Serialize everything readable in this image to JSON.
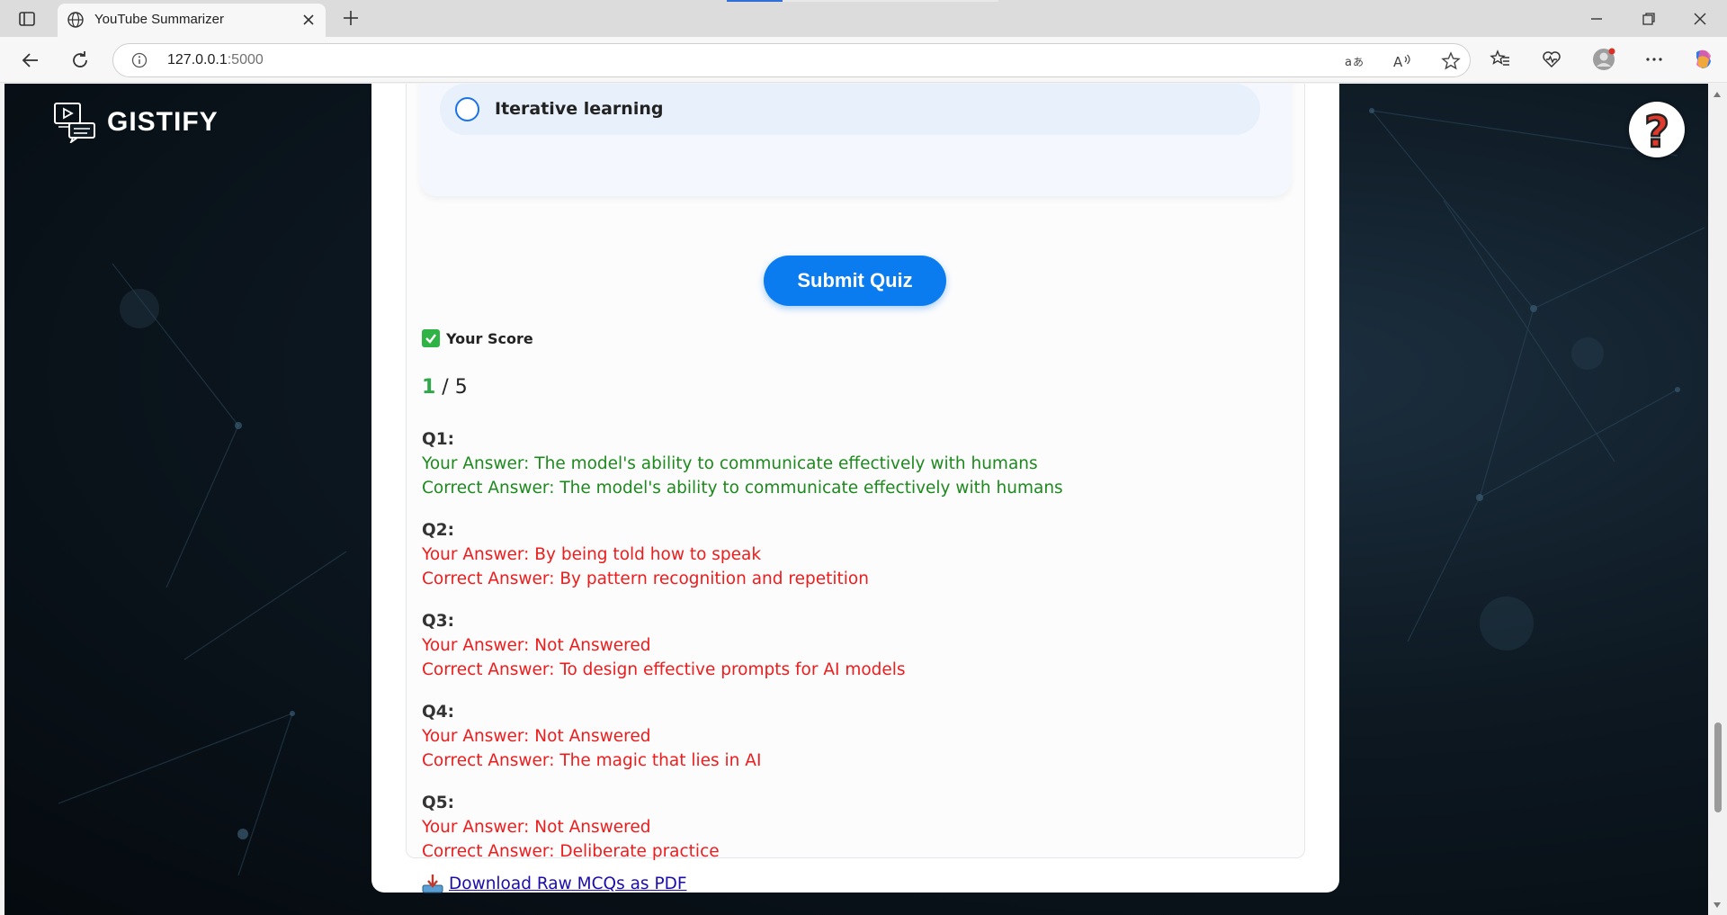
{
  "browser": {
    "tab_title": "YouTube Summarizer",
    "url_host": "127.0.0.1",
    "url_port": ":5000"
  },
  "app": {
    "brand": "GISTIFY",
    "help_symbol": "?"
  },
  "quiz": {
    "visible_option": "Iterative learning",
    "submit_label": "Submit Quiz",
    "score_heading": "Your Score",
    "score_got": "1",
    "score_sep": " / ",
    "score_total": "5",
    "results": [
      {
        "q": "Q1:",
        "your": "Your Answer: The model's ability to communicate effectively with humans",
        "correct": "Correct Answer: The model's ability to communicate effectively with humans",
        "status": "correct"
      },
      {
        "q": "Q2:",
        "your": "Your Answer: By being told how to speak",
        "correct": "Correct Answer: By pattern recognition and repetition",
        "status": "wrong"
      },
      {
        "q": "Q3:",
        "your": "Your Answer: Not Answered",
        "correct": "Correct Answer: To design effective prompts for AI models",
        "status": "wrong"
      },
      {
        "q": "Q4:",
        "your": "Your Answer: Not Answered",
        "correct": "Correct Answer: The magic that lies in AI",
        "status": "wrong"
      },
      {
        "q": "Q5:",
        "your": "Your Answer: Not Answered",
        "correct": "Correct Answer: Deliberate practice",
        "status": "wrong"
      }
    ],
    "download_label": "Download Raw MCQs as PDF"
  },
  "colors": {
    "accent": "#0b7bf0",
    "correct": "#1d8a1d",
    "wrong": "#ee1c1c",
    "score_good": "#2fa84a"
  }
}
